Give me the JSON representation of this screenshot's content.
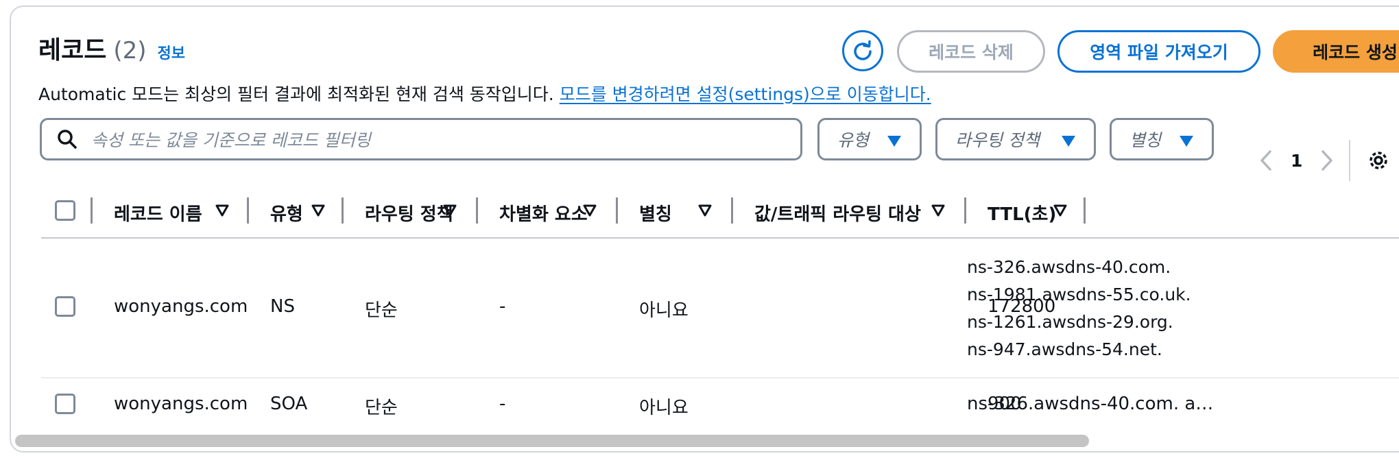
{
  "header": {
    "title": "레코드",
    "count": "(2)",
    "info_link": "정보",
    "description": "Automatic 모드는 최상의 필터 결과에 최적화된 현재 검색 동작입니다. ",
    "description_link": "모드를 변경하려면 설정(settings)으로 이동합니다."
  },
  "actions": {
    "refresh_icon": "refresh-icon",
    "delete_label": "레코드 삭제",
    "import_label": "영역 파일 가져오기",
    "create_label": "레코드 생성"
  },
  "filters": {
    "search_placeholder": "속성 또는 값을 기준으로 레코드 필터링",
    "type_label": "유형",
    "routing_label": "라우팅 정책",
    "alias_label": "별칭"
  },
  "pagination": {
    "current_page": "1"
  },
  "table": {
    "columns": [
      "레코드 이름",
      "유형",
      "라우팅 정책",
      "차별화 요소",
      "별칭",
      "값/트래픽 라우팅 대상",
      "TTL(초)"
    ],
    "rows": [
      {
        "name": "wonyangs.com",
        "type": "NS",
        "routing": "단순",
        "differentiator": "-",
        "alias": "아니요",
        "values": [
          "ns-326.awsdns-40.com.",
          "ns-1981.awsdns-55.co.uk.",
          "ns-1261.awsdns-29.org.",
          "ns-947.awsdns-54.net."
        ],
        "ttl": "172800"
      },
      {
        "name": "wonyangs.com",
        "type": "SOA",
        "routing": "단순",
        "differentiator": "-",
        "alias": "아니요",
        "value": "ns-326.awsdns-40.com. a…",
        "ttl": "900"
      }
    ]
  },
  "colors": {
    "accent_blue": "#0972d3",
    "primary_orange": "#f3a03d",
    "border_gray": "#7d8998",
    "disabled_gray": "#9ba7b6"
  }
}
